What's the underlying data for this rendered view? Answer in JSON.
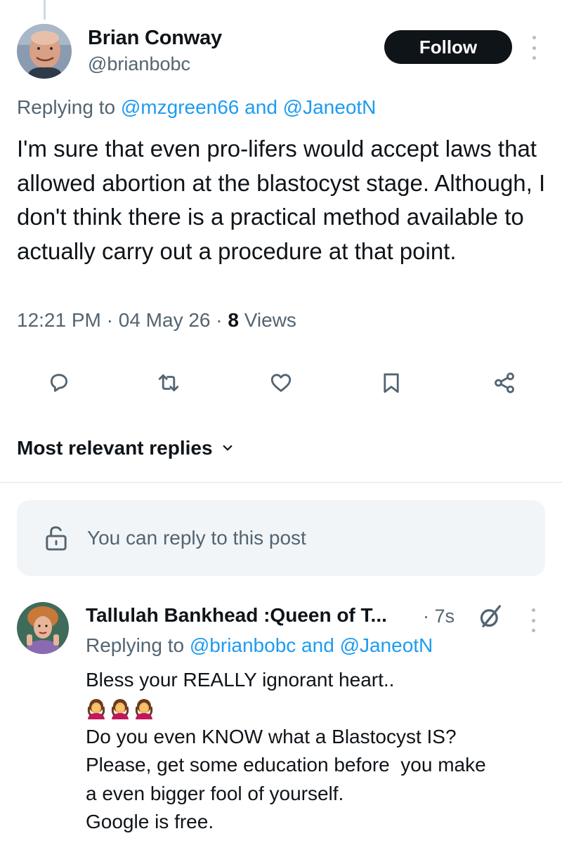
{
  "main_tweet": {
    "author_name": "Brian Conway",
    "author_handle": "@brianbobc",
    "follow_label": "Follow",
    "replying_prefix": "Replying to ",
    "replying_to_1": "@mzgreen66",
    "replying_and": " and ",
    "replying_to_2": "@JaneotN",
    "text": "I'm sure that even pro-lifers would accept laws that allowed abortion at the blastocyst stage. Although, I don't think there is a practical method available to actually carry out a procedure at that point.",
    "time": "12:21 PM",
    "date": "04 May 26",
    "separator": " · ",
    "views_count": "8",
    "views_label": " Views"
  },
  "actions": [
    {
      "name": "reply-icon"
    },
    {
      "name": "retweet-icon"
    },
    {
      "name": "like-icon"
    },
    {
      "name": "bookmark-icon"
    },
    {
      "name": "share-icon"
    }
  ],
  "sort": {
    "label": "Most relevant replies"
  },
  "reply_box": {
    "text": "You can reply to this post"
  },
  "reply_tweet": {
    "author_name": "Tallulah Bankhead :Queen of T...",
    "time": "· 7s",
    "replying_prefix": "Replying to ",
    "replying_to_1": "@brianbobc",
    "replying_and": " and ",
    "replying_to_2": "@JaneotN",
    "line1": "Bless your REALLY ignorant heart..",
    "emoji_count": 3,
    "line2": "Do you even KNOW what a Blastocyst IS?",
    "line3": "Please, get some education before  you make",
    "line4": "a even bigger fool of yourself.",
    "line5": "Google is free."
  },
  "colors": {
    "link": "#1d9bf0",
    "secondary_text": "#536471",
    "primary_text": "#0f1419",
    "follow_bg": "#0f1419"
  }
}
